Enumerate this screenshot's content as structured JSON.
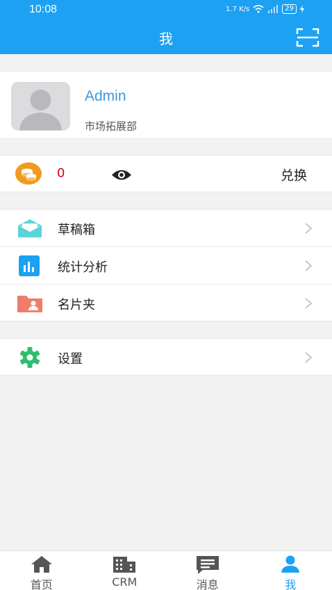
{
  "status": {
    "time": "10:08",
    "net_speed": "1.7 K/s",
    "battery": "29"
  },
  "header": {
    "title": "我"
  },
  "profile": {
    "name": "Admin",
    "department": "市场拓展部"
  },
  "points": {
    "value": "0",
    "exchange_label": "兑换"
  },
  "menu": {
    "items": [
      {
        "label": "草稿箱",
        "icon": "envelope-icon",
        "color": "#5ad3d8"
      },
      {
        "label": "统计分析",
        "icon": "bar-chart-icon",
        "color": "#1da1f2"
      },
      {
        "label": "名片夹",
        "icon": "contact-folder-icon",
        "color": "#ef7d6a"
      }
    ]
  },
  "settings": {
    "label": "设置",
    "icon": "gear-icon",
    "color": "#2fbe6f"
  },
  "tabbar": {
    "tabs": [
      {
        "label": "首页",
        "icon": "home-icon"
      },
      {
        "label": "CRM",
        "icon": "building-icon"
      },
      {
        "label": "消息",
        "icon": "message-icon"
      },
      {
        "label": "我",
        "icon": "user-icon",
        "active": true
      }
    ]
  },
  "colors": {
    "primary": "#1da1f2",
    "points": "#d0021b",
    "coin": "#f09a1e"
  }
}
